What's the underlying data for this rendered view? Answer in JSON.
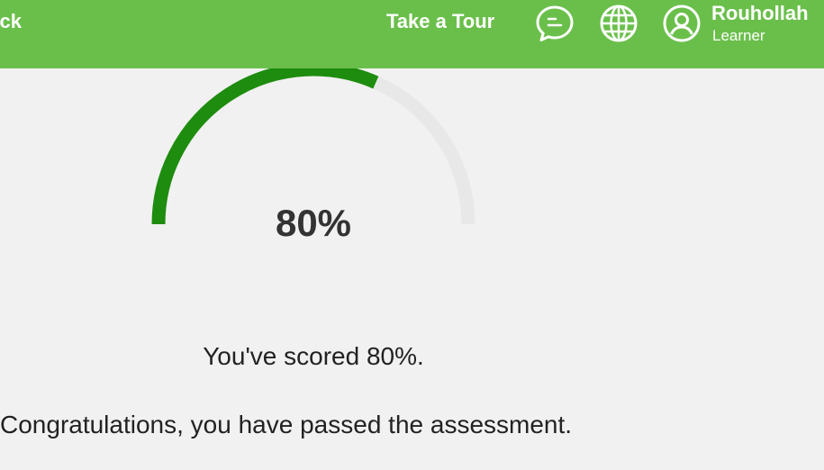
{
  "header": {
    "back_label": "Back",
    "tour_label": "Take a Tour",
    "chat_icon": "chat-icon",
    "language_icon": "globe-icon",
    "avatar_icon": "user-avatar-icon",
    "user": {
      "name": "Rouhollah",
      "role": "Learner"
    }
  },
  "result": {
    "score_percent": 80,
    "score_label": "80%",
    "scored_message": "You've scored 80%.",
    "pass_message": "Congratulations, you have passed the assessment."
  },
  "colors": {
    "header_bg": "#6abf4b",
    "gauge_progress": "#1e8c0e",
    "gauge_track": "#e8e8e8",
    "page_bg": "#f1f1f1"
  }
}
